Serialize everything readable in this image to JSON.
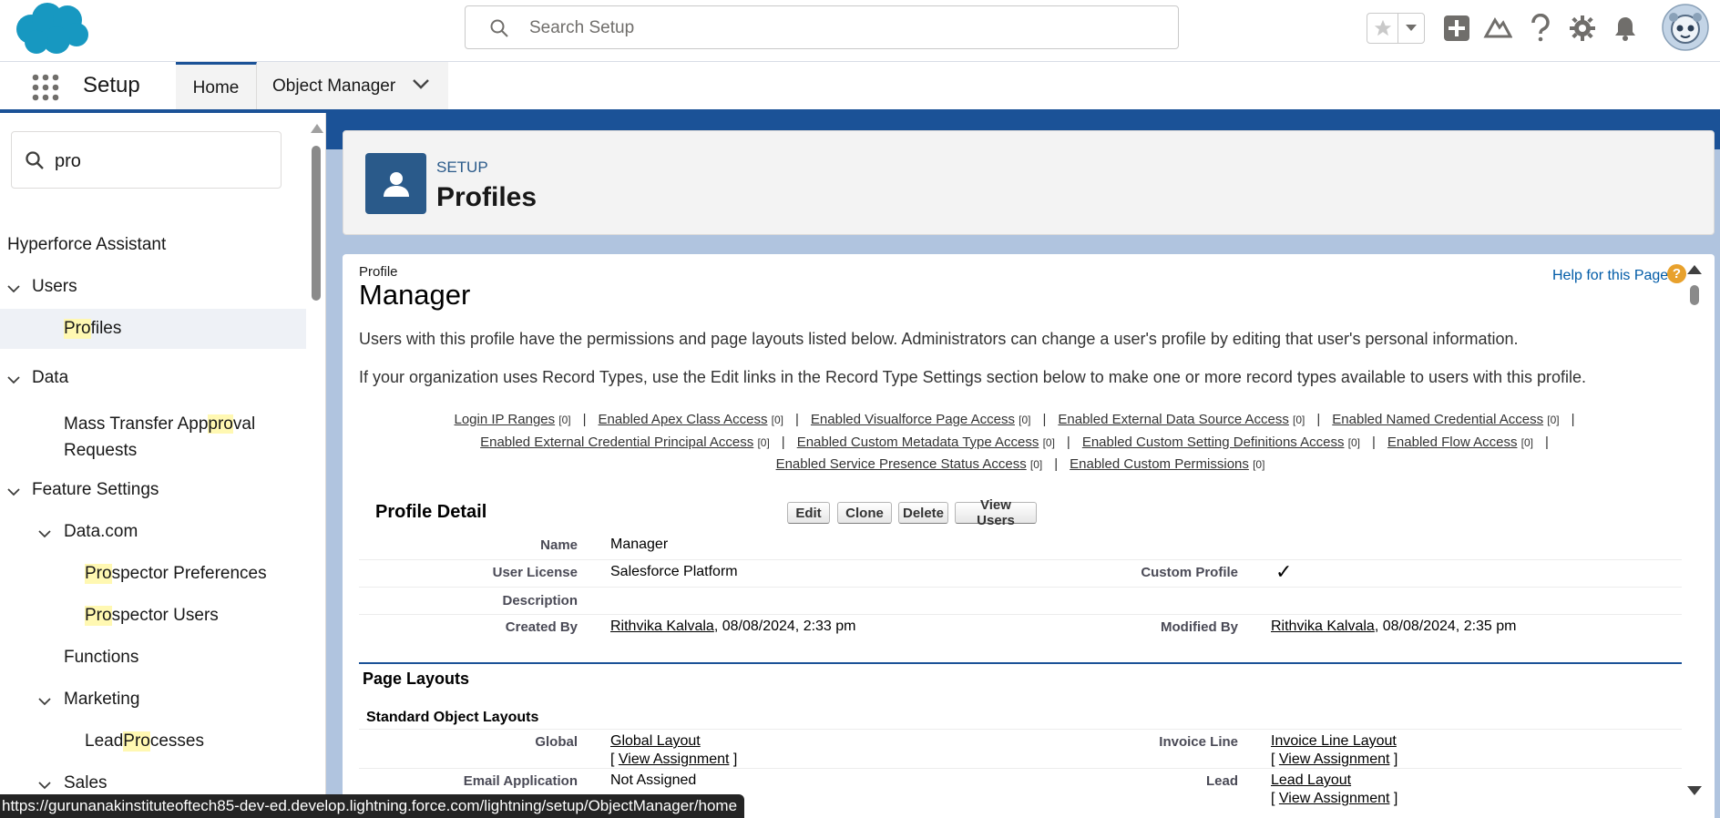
{
  "header": {
    "search_placeholder": "Search Setup"
  },
  "app_nav": {
    "app_name": "Setup",
    "tabs": [
      {
        "label": "Home"
      },
      {
        "label": "Object Manager"
      }
    ]
  },
  "sidebar": {
    "quickfind_value": "pro",
    "items": [
      {
        "label": "Hyperforce Assistant"
      },
      {
        "label": "Users"
      },
      {
        "hl": "Pro",
        "rest": "files"
      },
      {
        "label": "Data"
      },
      {
        "pre": "Mass Transfer App",
        "hl": "pro",
        "rest": "val",
        "line2": "Requests"
      },
      {
        "label": "Feature Settings"
      },
      {
        "label": "Data.com"
      },
      {
        "hl": "Pro",
        "rest": "spector Preferences"
      },
      {
        "hl": "Pro",
        "rest": "spector Users"
      },
      {
        "label": "Functions"
      },
      {
        "label": "Marketing"
      },
      {
        "pre": "Lead ",
        "hl": "Pro",
        "rest": "cesses"
      },
      {
        "label": "Sales"
      }
    ]
  },
  "page_header": {
    "section": "SETUP",
    "title": "Profiles"
  },
  "profile": {
    "type_label": "Profile",
    "name": "Manager",
    "help_link": "Help for this Page",
    "help_icon_glyph": "?",
    "description_1": "Users with this profile have the permissions and page layouts listed below. Administrators can change a user's profile by editing that user's personal information.",
    "description_2": "If your organization uses Record Types, use the Edit links in the Record Type Settings section below to make one or more record types available to users with this profile."
  },
  "related_links": [
    {
      "label": "Login IP Ranges",
      "count": "[0]"
    },
    {
      "label": "Enabled Apex Class Access",
      "count": "[0]"
    },
    {
      "label": "Enabled Visualforce Page Access",
      "count": "[0]"
    },
    {
      "label": "Enabled External Data Source Access",
      "count": "[0]"
    },
    {
      "label": "Enabled Named Credential Access",
      "count": "[0]"
    },
    {
      "label": "Enabled External Credential Principal Access",
      "count": "[0]"
    },
    {
      "label": "Enabled Custom Metadata Type Access",
      "count": "[0]"
    },
    {
      "label": "Enabled Custom Setting Definitions Access",
      "count": "[0]"
    },
    {
      "label": "Enabled Flow Access",
      "count": "[0]"
    },
    {
      "label": "Enabled Service Presence Status Access",
      "count": "[0]"
    },
    {
      "label": "Enabled Custom Permissions",
      "count": "[0]"
    }
  ],
  "profile_detail": {
    "title": "Profile Detail",
    "buttons": {
      "edit": "Edit",
      "clone": "Clone",
      "delete": "Delete",
      "view_users": "View Users"
    },
    "fields": {
      "name_label": "Name",
      "name_value": "Manager",
      "license_label": "User License",
      "license_value": "Salesforce Platform",
      "custom_label": "Custom Profile",
      "custom_checked": "✓",
      "description_label": "Description",
      "created_label": "Created By",
      "created_user": "Rithvika Kalvala",
      "created_date": ", 08/08/2024, 2:33 pm",
      "modified_label": "Modified By",
      "modified_user": "Rithvika Kalvala",
      "modified_date": ", 08/08/2024, 2:35 pm"
    }
  },
  "page_layouts": {
    "title": "Page Layouts",
    "standard_title": "Standard Object Layouts",
    "view_assignment": "View Assignment",
    "rows": [
      {
        "left_label": "Global",
        "left_value": "Global Layout",
        "right_label": "Invoice Line",
        "right_value": "Invoice Line Layout"
      },
      {
        "left_label": "Email Application",
        "left_value": "Not Assigned",
        "right_label": "Lead",
        "right_value": "Lead Layout"
      }
    ]
  },
  "status_bar": {
    "url": "https://gurunanakinstituteoftech85-dev-ed.develop.lightning.force.com/lightning/setup/ObjectManager/home"
  },
  "colors": {
    "brand_blue": "#1b5297",
    "profile_icon": "#2a5a8a",
    "highlight": "#fff8b2",
    "help_orange": "#e8a12c",
    "salesforce_cloud": "#1798c1"
  }
}
